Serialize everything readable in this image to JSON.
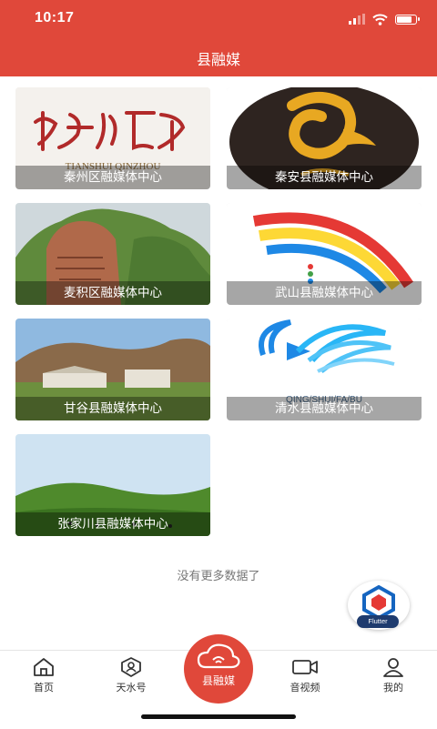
{
  "status_bar": {
    "time": "10:17",
    "battery_level": 0.85
  },
  "header": {
    "title": "县融媒"
  },
  "cards": [
    {
      "label": "秦州区融媒体中心",
      "logo_text": "TIANSHUI QINZHOU"
    },
    {
      "label": "秦安县融媒体中心"
    },
    {
      "label": "麦积区融媒体中心"
    },
    {
      "label": "武山县融媒体中心"
    },
    {
      "label": "甘谷县融媒体中心"
    },
    {
      "label": "清水县融媒体中心",
      "logo_text": "QING/SHUI/FA/BU"
    },
    {
      "label": "张家川县融媒体中心"
    }
  ],
  "list_footer": "没有更多数据了",
  "floating_badge": "Flutter",
  "tabs": [
    {
      "label": "首页",
      "icon": "home-icon"
    },
    {
      "label": "天水号",
      "icon": "account-icon"
    },
    {
      "label": "县融媒",
      "icon": "media-icon",
      "active": true
    },
    {
      "label": "音视频",
      "icon": "video-icon"
    },
    {
      "label": "我的",
      "icon": "user-icon"
    }
  ],
  "colors": {
    "accent": "#E0483A",
    "nav_blue": "#1E3B6E"
  }
}
